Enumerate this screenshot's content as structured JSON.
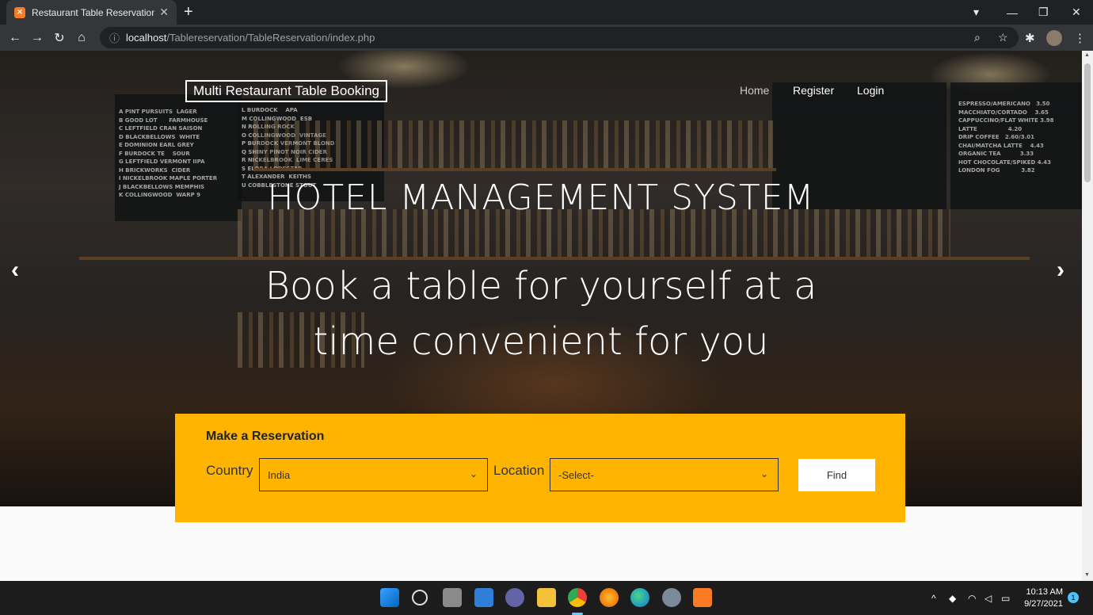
{
  "browser": {
    "tab_title": "Restaurant Table Reservation Sys",
    "url_host": "localhost",
    "url_path": "/Tablereservation/TableReservation/index.php"
  },
  "site": {
    "brand": "Multi Restaurant Table Booking",
    "nav": [
      "Home",
      "Register",
      "Login"
    ],
    "hero_title": "HOTEL MANAGEMENT SYSTEM",
    "hero_subtitle": "Book a table for yourself at a time convenient for you"
  },
  "reservation": {
    "title": "Make a Reservation",
    "country_label": "Country",
    "country_value": "India",
    "location_label": "Location",
    "location_value": "-Select-",
    "find_label": "Find"
  },
  "taskbar": {
    "time": "10:13 AM",
    "date": "9/27/2021",
    "notification_count": "1"
  },
  "colors": {
    "accent": "#ffb400",
    "chrome_dark": "#202124"
  }
}
